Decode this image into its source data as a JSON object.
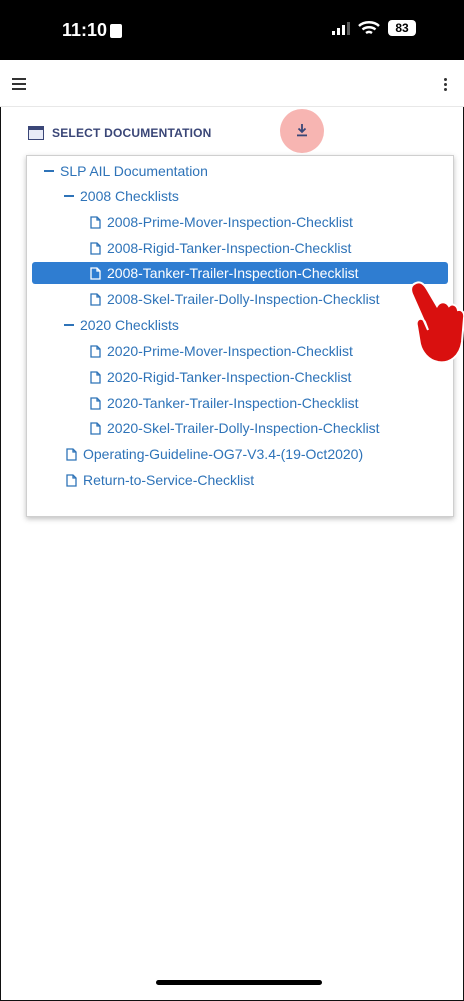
{
  "status_bar": {
    "time": "11:10",
    "battery": "83"
  },
  "toolbar": {
    "select_documentation": "SELECT DOCUMENTATION"
  },
  "tree": {
    "root": "SLP AIL Documentation",
    "group_2008": "2008 Checklists",
    "items_2008": [
      "2008-Prime-Mover-Inspection-Checklist",
      "2008-Rigid-Tanker-Inspection-Checklist",
      "2008-Tanker-Trailer-Inspection-Checklist",
      "2008-Skel-Trailer-Dolly-Inspection-Checklist"
    ],
    "group_2020": "2020 Checklists",
    "items_2020": [
      "2020-Prime-Mover-Inspection-Checklist",
      "2020-Rigid-Tanker-Inspection-Checklist",
      "2020-Tanker-Trailer-Inspection-Checklist",
      "2020-Skel-Trailer-Dolly-Inspection-Checklist"
    ],
    "other_items": [
      "Operating-Guideline-OG7-V3.4-(19-Oct2020)",
      "Return-to-Service-Checklist"
    ]
  },
  "colors": {
    "link": "#2e73b8",
    "selected_bg": "#2f7dd1",
    "download_highlight": "#f7b5b2",
    "pointer_hand": "#d9100f"
  },
  "icons": [
    "menu-icon",
    "more-vertical-icon",
    "calendar-icon",
    "download-icon",
    "file-icon",
    "pointer-hand-icon"
  ]
}
